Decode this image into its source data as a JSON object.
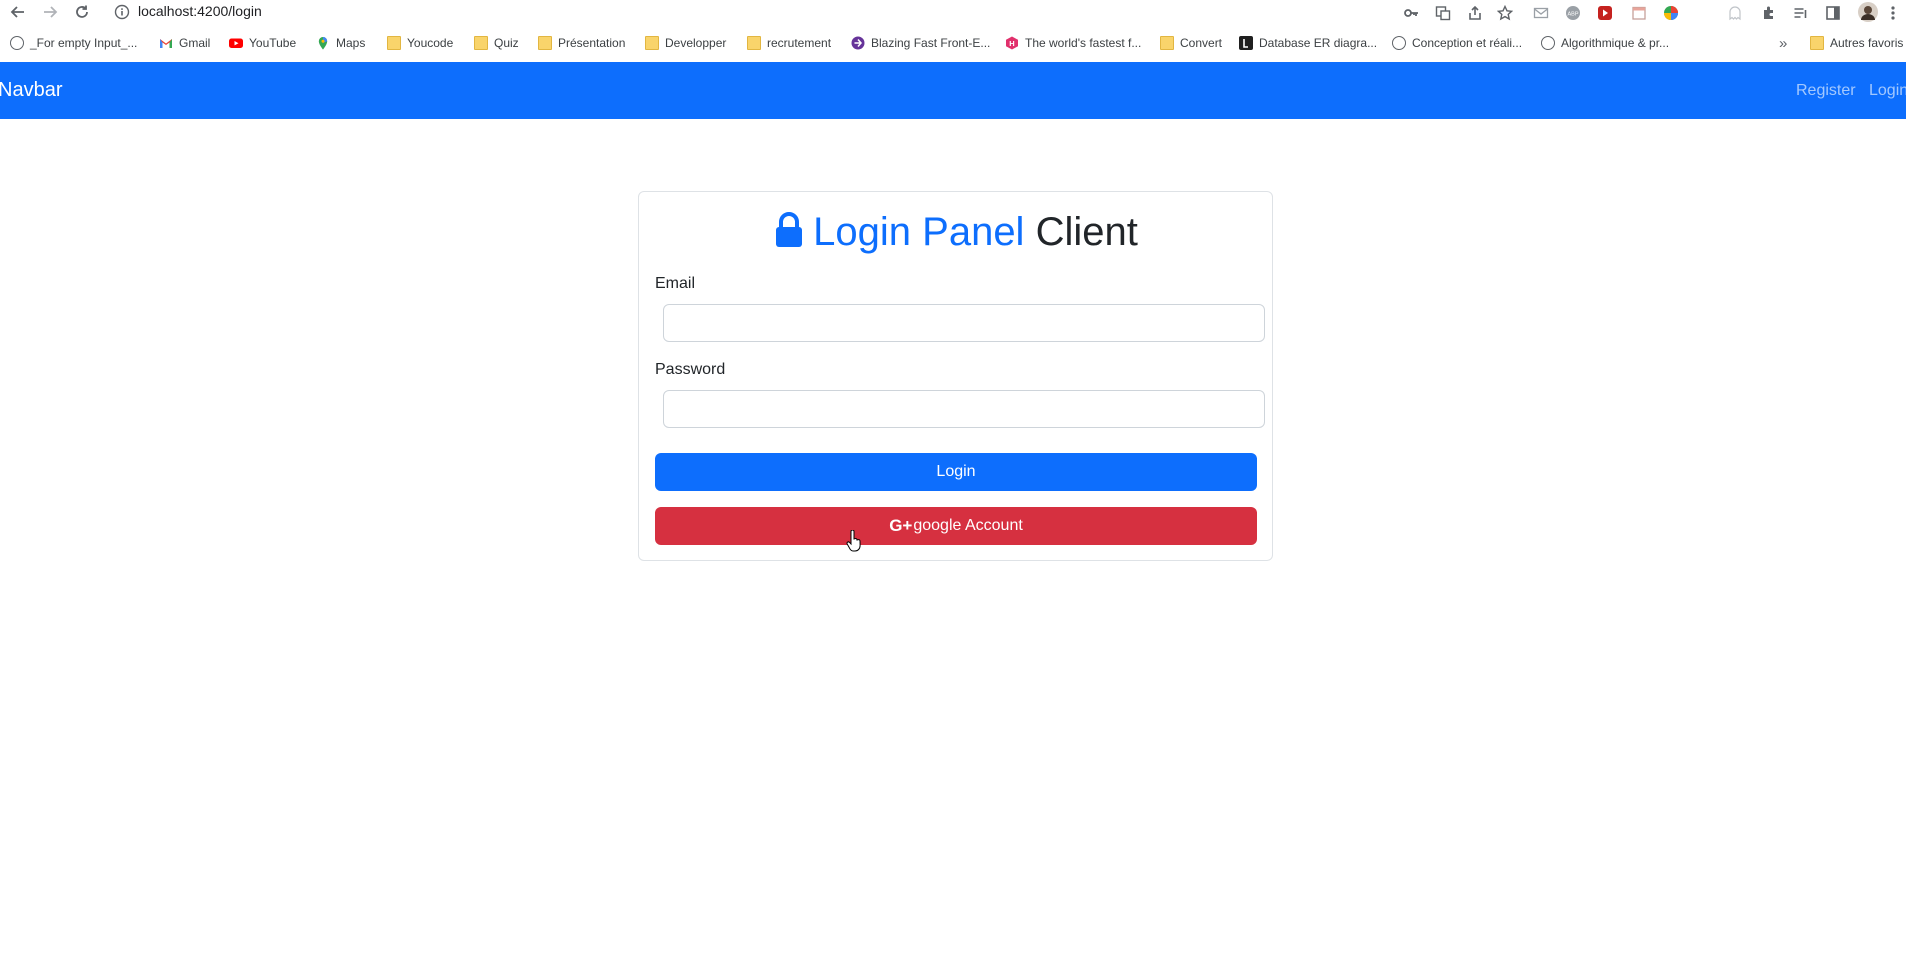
{
  "browser": {
    "url": "localhost:4200/login",
    "bookmarks": [
      {
        "label": "_For empty Input_...",
        "icon": "globe-icon"
      },
      {
        "label": "Gmail",
        "icon": "gmail-icon"
      },
      {
        "label": "YouTube",
        "icon": "youtube-icon"
      },
      {
        "label": "Maps",
        "icon": "maps-icon"
      },
      {
        "label": "Youcode",
        "icon": "folder-icon"
      },
      {
        "label": "Quiz",
        "icon": "folder-icon"
      },
      {
        "label": "Présentation",
        "icon": "folder-icon"
      },
      {
        "label": "Developper",
        "icon": "folder-icon"
      },
      {
        "label": "recrutement",
        "icon": "folder-icon"
      },
      {
        "label": "Blazing Fast Front-E...",
        "icon": "site-icon"
      },
      {
        "label": "The world's fastest f...",
        "icon": "site-icon"
      },
      {
        "label": "Convert",
        "icon": "folder-icon"
      },
      {
        "label": "Database ER diagra...",
        "icon": "site-icon"
      },
      {
        "label": "Conception et réali...",
        "icon": "globe-icon"
      },
      {
        "label": "Algorithmique & pr...",
        "icon": "globe-icon"
      }
    ],
    "overflow": "»",
    "other_bookmarks": "Autres favoris"
  },
  "navbar": {
    "brand": "Navbar",
    "links": [
      "Register",
      "Login"
    ]
  },
  "login_card": {
    "title_blue": "Login Panel",
    "title_dark": "Client",
    "email_label": "Email",
    "email_value": "",
    "password_label": "Password",
    "password_value": "",
    "login_button": "Login",
    "google_icon": "G+",
    "google_button": "google Account"
  },
  "colors": {
    "primary": "#0d6efd",
    "danger": "#d63040",
    "navbar_link": "rgba(255,255,255,0.62)"
  }
}
